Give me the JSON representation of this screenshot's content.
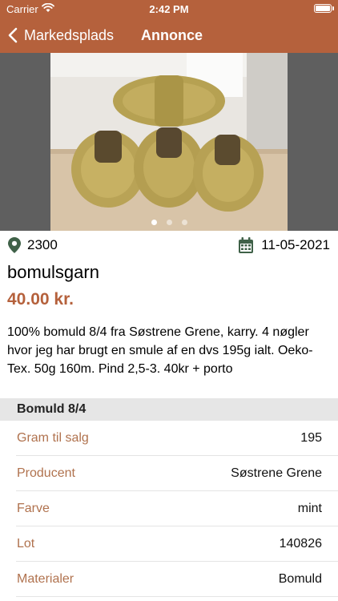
{
  "status_bar": {
    "carrier": "Carrier",
    "time": "2:42 PM"
  },
  "nav": {
    "back_label": "Markedsplads",
    "title": "Annonce"
  },
  "gallery": {
    "image_subject": "four skeins of mustard yellow cotton yarn",
    "page_count": 3,
    "current_page": 1
  },
  "listing": {
    "zip": "2300",
    "date": "11-05-2021",
    "title": "bomulsgarn",
    "price": "40.00 kr.",
    "description": "100% bomuld 8/4 fra Søstrene Grene, karry. 4 nøgler hvor jeg har brugt en smule af en dvs 195g ialt. Oeko-Tex. 50g 160m. Pind 2,5-3. 40kr + porto"
  },
  "details": {
    "section_title": "Bomuld 8/4",
    "rows": [
      {
        "label": "Gram til salg",
        "value": "195"
      },
      {
        "label": "Producent",
        "value": "Søstrene Grene"
      },
      {
        "label": "Farve",
        "value": "mint"
      },
      {
        "label": "Lot",
        "value": "140826"
      },
      {
        "label": "Materialer",
        "value": "Bomuld"
      }
    ]
  },
  "colors": {
    "accent": "#b5613c",
    "label": "#b0724e",
    "icon": "#3f6148"
  }
}
